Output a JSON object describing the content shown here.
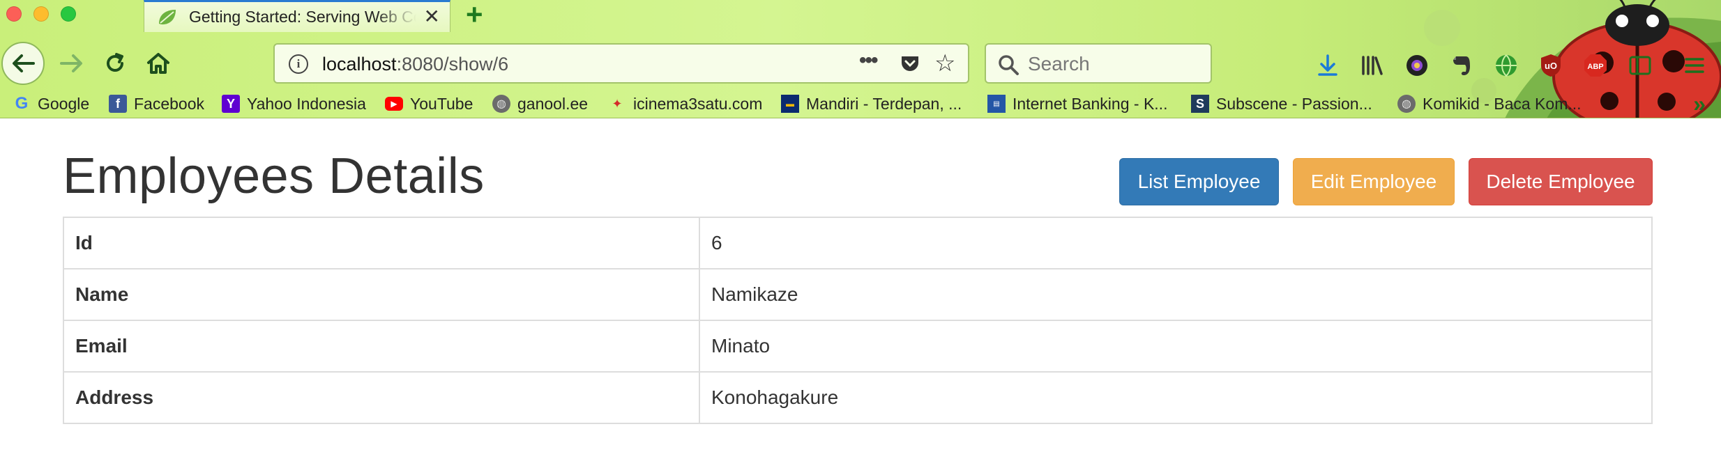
{
  "browser": {
    "tab": {
      "title": "Getting Started: Serving Web Content",
      "close_icon": "close-icon"
    },
    "url": {
      "host": "localhost",
      "rest": ":8080/show/6"
    },
    "search": {
      "placeholder": "Search"
    },
    "bookmarks": [
      {
        "label": "Google",
        "icon": "google-icon"
      },
      {
        "label": "Facebook",
        "icon": "facebook-icon"
      },
      {
        "label": "Yahoo Indonesia",
        "icon": "yahoo-icon"
      },
      {
        "label": "YouTube",
        "icon": "youtube-icon"
      },
      {
        "label": "ganool.ee",
        "icon": "globe-icon"
      },
      {
        "label": "icinema3satu.com",
        "icon": "icinema-icon"
      },
      {
        "label": "Mandiri - Terdepan, ...",
        "icon": "mandiri-icon"
      },
      {
        "label": "Internet Banking - K...",
        "icon": "bank-icon"
      },
      {
        "label": "Subscene - Passion...",
        "icon": "subscene-icon"
      },
      {
        "label": "Komikid - Baca Kom...",
        "icon": "globe-icon"
      }
    ],
    "colors": {
      "theme_green": "#c9ef7a",
      "tab_accent": "#2b7bd1"
    }
  },
  "page": {
    "title": "Employees Details",
    "buttons": {
      "list": "List Employee",
      "edit": "Edit Employee",
      "delete": "Delete Employee"
    },
    "button_colors": {
      "list": "#337ab7",
      "edit": "#f0ad4e",
      "delete": "#d9534f"
    },
    "details": [
      {
        "label": "Id",
        "value": "6"
      },
      {
        "label": "Name",
        "value": "Namikaze"
      },
      {
        "label": "Email",
        "value": "Minato"
      },
      {
        "label": "Address",
        "value": "Konohagakure"
      }
    ]
  }
}
